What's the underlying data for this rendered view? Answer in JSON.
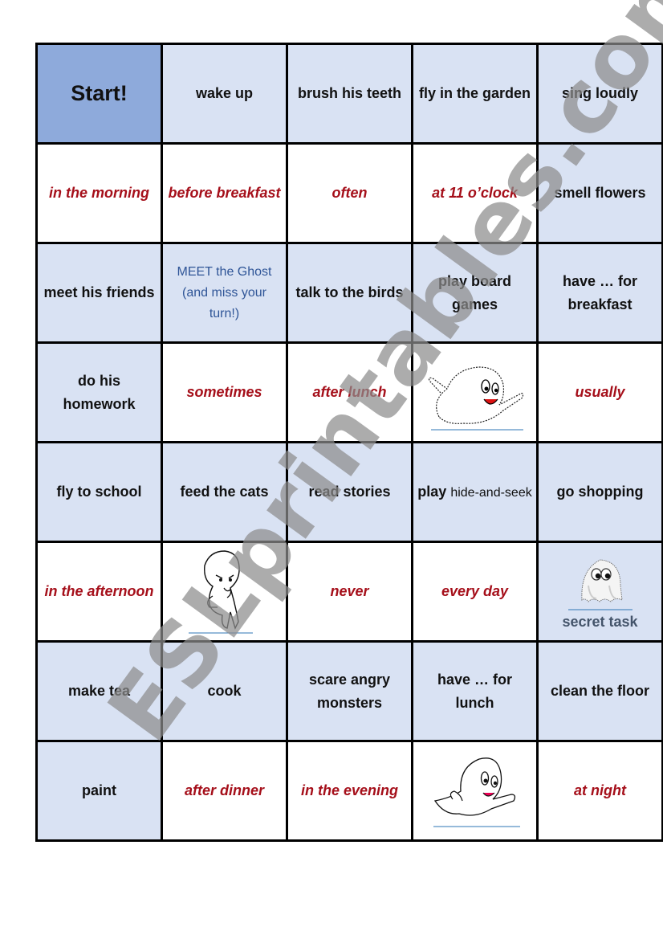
{
  "board": {
    "rows": [
      [
        {
          "text": "Start!",
          "style": "start"
        },
        {
          "text": "wake up",
          "style": "blue"
        },
        {
          "text": "brush his teeth",
          "style": "blue"
        },
        {
          "text": "fly in the garden",
          "style": "blue"
        },
        {
          "text": "sing loudly",
          "style": "blue"
        }
      ],
      [
        {
          "text": "in the morning",
          "style": "time"
        },
        {
          "text": "before breakfast",
          "style": "time"
        },
        {
          "text": "often",
          "style": "time"
        },
        {
          "text": "at 11 o’clock",
          "style": "time"
        },
        {
          "text": "smell flowers",
          "style": "blue"
        }
      ],
      [
        {
          "text": "meet his friends",
          "style": "blue"
        },
        {
          "text": "MEET the Ghost (and miss your turn!)",
          "style": "meet"
        },
        {
          "text": "talk to the birds",
          "style": "blue"
        },
        {
          "text": "play board games",
          "style": "blue"
        },
        {
          "text": "have … for breakfast",
          "style": "blue"
        }
      ],
      [
        {
          "text": "do his homework",
          "style": "blue"
        },
        {
          "text": "sometimes",
          "style": "time"
        },
        {
          "text": "after lunch",
          "style": "time"
        },
        {
          "text": "",
          "style": "image",
          "icon": "flying-ghost-waving-icon"
        },
        {
          "text": "usually",
          "style": "time"
        }
      ],
      [
        {
          "text": "fly to school",
          "style": "blue"
        },
        {
          "text": "feed the cats",
          "style": "blue"
        },
        {
          "text": "read stories",
          "style": "blue"
        },
        {
          "text": "play",
          "text_small": "hide-and-seek",
          "style": "blue-mixed"
        },
        {
          "text": "go shopping",
          "style": "blue"
        }
      ],
      [
        {
          "text": "in the afternoon",
          "style": "time"
        },
        {
          "text": "",
          "style": "image",
          "icon": "thinking-ghost-icon"
        },
        {
          "text": "never",
          "style": "time"
        },
        {
          "text": "every day",
          "style": "time"
        },
        {
          "text": "secret task",
          "style": "secret",
          "icon": "sheet-ghost-icon"
        }
      ],
      [
        {
          "text": "make tea",
          "style": "blue"
        },
        {
          "text": "cook",
          "style": "blue"
        },
        {
          "text": "scare angry monsters",
          "style": "blue"
        },
        {
          "text": "have … for lunch",
          "style": "blue"
        },
        {
          "text": "clean the floor",
          "style": "blue"
        }
      ],
      [
        {
          "text": "paint",
          "style": "blue"
        },
        {
          "text": "after dinner",
          "style": "time"
        },
        {
          "text": "in the evening",
          "style": "time"
        },
        {
          "text": "",
          "style": "image",
          "icon": "flying-ghost-smiling-icon"
        },
        {
          "text": "at night",
          "style": "time"
        }
      ]
    ]
  },
  "watermark": {
    "text": "ESLprintables.com"
  },
  "colors": {
    "start_cell": "#8EAADB",
    "activity_cell": "#D9E2F3",
    "time_text": "#A50F1A",
    "meet_text": "#2F5597",
    "secret_text": "#44546A",
    "watermark": "#8C8C8C"
  }
}
